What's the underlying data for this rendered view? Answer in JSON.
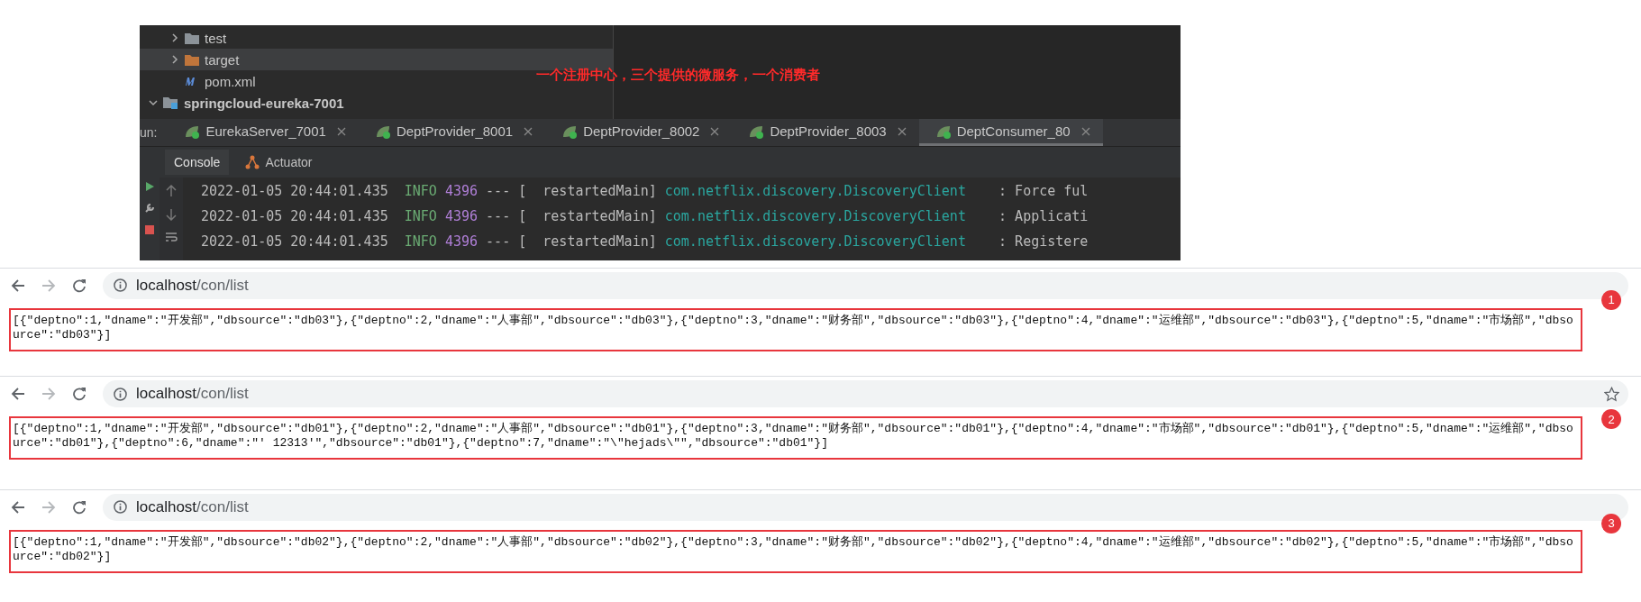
{
  "ide": {
    "tree": [
      {
        "label": "test",
        "kind": "folder",
        "expanded": false,
        "selected": false
      },
      {
        "label": "target",
        "kind": "build-folder",
        "expanded": false,
        "selected": true
      },
      {
        "label": "pom.xml",
        "kind": "maven",
        "selected": false
      },
      {
        "label": "springcloud-eureka-7001",
        "kind": "module",
        "expanded": true,
        "selected": false
      }
    ],
    "annotation": "一个注册中心，三个提供的微服务，一个消费者",
    "run_label": "un:",
    "run_tabs": [
      {
        "label": "EurekaServer_7001",
        "selected": false
      },
      {
        "label": "DeptProvider_8001",
        "selected": false
      },
      {
        "label": "DeptProvider_8002",
        "selected": false
      },
      {
        "label": "DeptProvider_8003",
        "selected": false
      },
      {
        "label": "DeptConsumer_80",
        "selected": true
      }
    ],
    "tool_tabs": [
      {
        "label": "Console",
        "selected": true
      },
      {
        "label": "Actuator",
        "selected": false
      }
    ],
    "log_lines": [
      {
        "time": "2022-01-05 20:44:01.435",
        "level": "INFO",
        "pid": "4396",
        "sep": "--- [",
        "thread": "  restartedMain]",
        "logger": "com.netflix.discovery.DiscoveryClient",
        "message": ": Force ful"
      },
      {
        "time": "2022-01-05 20:44:01.435",
        "level": "INFO",
        "pid": "4396",
        "sep": "--- [",
        "thread": "  restartedMain]",
        "logger": "com.netflix.discovery.DiscoveryClient",
        "message": ": Applicati"
      },
      {
        "time": "2022-01-05 20:44:01.435",
        "level": "INFO",
        "pid": "4396",
        "sep": "--- [",
        "thread": "  restartedMain]",
        "logger": "com.netflix.discovery.DiscoveryClient",
        "message": ": Registere"
      }
    ]
  },
  "browsers": [
    {
      "host": "localhost",
      "path": "/con/list",
      "badge": "1",
      "bookmark_star": false,
      "body": "[{\"deptno\":1,\"dname\":\"开发部\",\"dbsource\":\"db03\"},{\"deptno\":2,\"dname\":\"人事部\",\"dbsource\":\"db03\"},{\"deptno\":3,\"dname\":\"财务部\",\"dbsource\":\"db03\"},{\"deptno\":4,\"dname\":\"运维部\",\"dbsource\":\"db03\"},{\"deptno\":5,\"dname\":\"市场部\",\"dbsource\":\"db03\"}]"
    },
    {
      "host": "localhost",
      "path": "/con/list",
      "badge": "2",
      "bookmark_star": true,
      "body": "[{\"deptno\":1,\"dname\":\"开发部\",\"dbsource\":\"db01\"},{\"deptno\":2,\"dname\":\"人事部\",\"dbsource\":\"db01\"},{\"deptno\":3,\"dname\":\"财务部\",\"dbsource\":\"db01\"},{\"deptno\":4,\"dname\":\"市场部\",\"dbsource\":\"db01\"},{\"deptno\":5,\"dname\":\"运维部\",\"dbsource\":\"db01\"},{\"deptno\":6,\"dname\":\"' 12313'\",\"dbsource\":\"db01\"},{\"deptno\":7,\"dname\":\"\\\"hejads\\\"\",\"dbsource\":\"db01\"}]"
    },
    {
      "host": "localhost",
      "path": "/con/list",
      "badge": "3",
      "bookmark_star": false,
      "body": "[{\"deptno\":1,\"dname\":\"开发部\",\"dbsource\":\"db02\"},{\"deptno\":2,\"dname\":\"人事部\",\"dbsource\":\"db02\"},{\"deptno\":3,\"dname\":\"财务部\",\"dbsource\":\"db02\"},{\"deptno\":4,\"dname\":\"运维部\",\"dbsource\":\"db02\"},{\"deptno\":5,\"dname\":\"市场部\",\"dbsource\":\"db02\"}]"
    }
  ]
}
